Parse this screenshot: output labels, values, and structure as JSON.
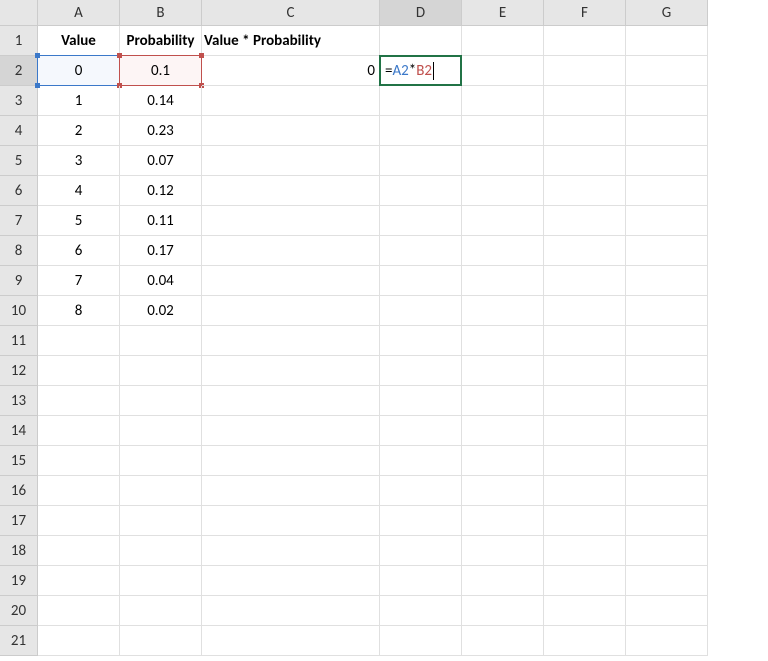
{
  "columns": [
    "A",
    "B",
    "C",
    "D",
    "E",
    "F",
    "G"
  ],
  "rowCount": 21,
  "activeCol": "D",
  "activeRow": 2,
  "headers": {
    "A": "Value",
    "B": "Probability",
    "C": "Value * Probability"
  },
  "rows": [
    {
      "value": "0",
      "prob": "0.1",
      "result": "0"
    },
    {
      "value": "1",
      "prob": "0.14"
    },
    {
      "value": "2",
      "prob": "0.23"
    },
    {
      "value": "3",
      "prob": "0.07"
    },
    {
      "value": "4",
      "prob": "0.12"
    },
    {
      "value": "5",
      "prob": "0.11"
    },
    {
      "value": "6",
      "prob": "0.17"
    },
    {
      "value": "7",
      "prob": "0.04"
    },
    {
      "value": "8",
      "prob": "0.02"
    }
  ],
  "formula": {
    "eq": "=",
    "ref1": "A2",
    "op": "*",
    "ref2": "B2"
  }
}
